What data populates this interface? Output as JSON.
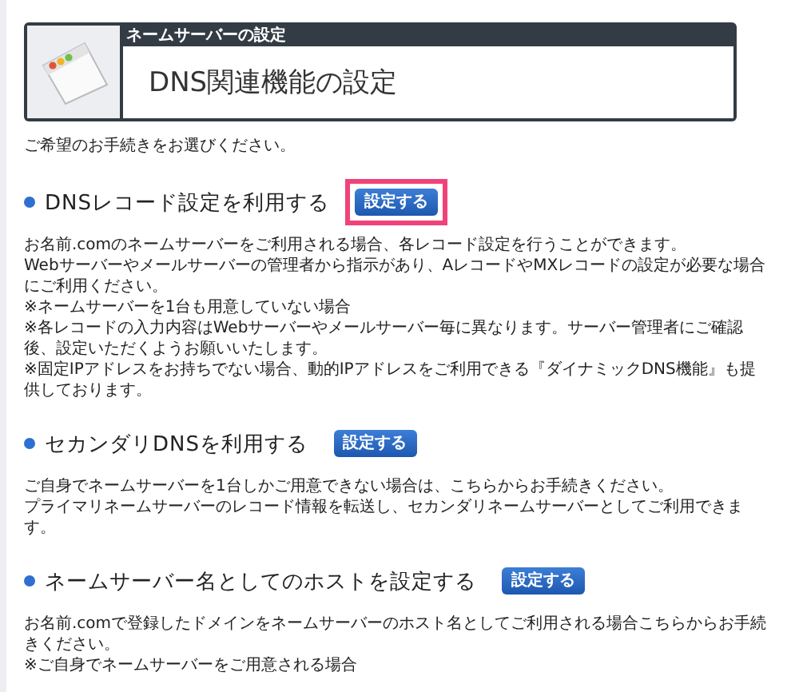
{
  "header": {
    "category": "ネームサーバーの設定",
    "title": "DNS関連機能の設定"
  },
  "intro": "ご希望のお手続きをお選びください。",
  "sections": [
    {
      "title": "DNSレコード設定を利用する",
      "button": "設定する",
      "highlighted": true,
      "lines": [
        "お名前.comのネームサーバーをご利用される場合、各レコード設定を行うことができます。",
        "Webサーバーやメールサーバーの管理者から指示があり、AレコードやMXレコードの設定が必要な場合にご利用ください。",
        "※ネームサーバーを1台も用意していない場合",
        "※各レコードの入力内容はWebサーバーやメールサーバー毎に異なります。サーバー管理者にご確認後、設定いただくようお願いいたします。",
        "※固定IPアドレスをお持ちでない場合、動的IPアドレスをご利用できる『ダイナミックDNS機能』も提供しております。"
      ]
    },
    {
      "title": "セカンダリDNSを利用する",
      "button": "設定する",
      "highlighted": false,
      "lines": [
        "ご自身でネームサーバーを1台しかご用意できない場合は、こちらからお手続きください。",
        "プライマリネームサーバーのレコード情報を転送し、セカンダリネームサーバーとしてご利用できます。"
      ]
    },
    {
      "title": "ネームサーバー名としてのホストを設定する",
      "button": "設定する",
      "highlighted": false,
      "lines": [
        "お名前.comで登録したドメインをネームサーバーのホスト名としてご利用される場合こちらからお手続きください。",
        "※ご自身でネームサーバーをご用意される場合"
      ]
    }
  ]
}
